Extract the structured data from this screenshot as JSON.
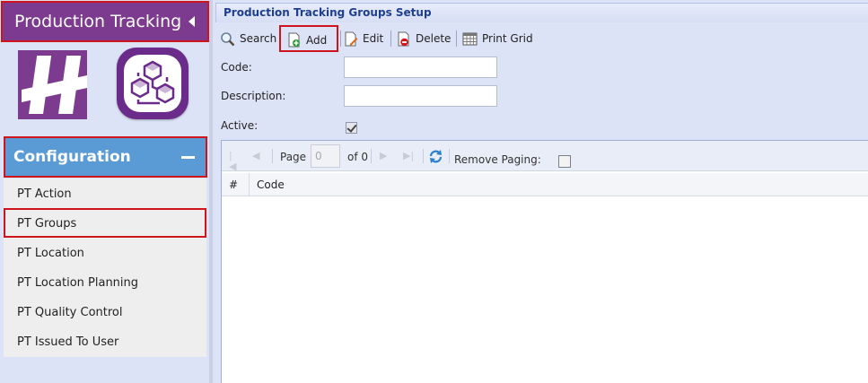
{
  "sidebar": {
    "header_title": "Production Tracking",
    "config_title": "Configuration",
    "items": [
      {
        "label": "PT Action"
      },
      {
        "label": "PT Groups"
      },
      {
        "label": "PT Location"
      },
      {
        "label": "PT Location Planning"
      },
      {
        "label": "PT Quality Control"
      },
      {
        "label": "PT Issued To User"
      }
    ],
    "active_index": 1,
    "colors": {
      "brand_purple": "#7d3b8f",
      "config_blue": "#5b9bd5",
      "highlight_red": "#d0141b"
    }
  },
  "main": {
    "title": "Production Tracking Groups Setup",
    "toolbar": {
      "search": {
        "label": "Search",
        "icon": "magnifier-icon"
      },
      "add": {
        "label": "Add",
        "icon": "add-document-icon"
      },
      "edit": {
        "label": "Edit",
        "icon": "edit-document-icon"
      },
      "delete": {
        "label": "Delete",
        "icon": "delete-document-icon"
      },
      "print": {
        "label": "Print Grid",
        "icon": "grid-table-icon"
      }
    },
    "form": {
      "code_label": "Code:",
      "code_value": "",
      "description_label": "Description:",
      "description_value": "",
      "active_label": "Active:",
      "active_checked": true
    },
    "grid": {
      "pager": {
        "page_label": "Page",
        "page_value": "0",
        "of_label": "of 0",
        "remove_paging_label": "Remove Paging:",
        "remove_paging_checked": false
      },
      "columns": [
        "#",
        "Code"
      ],
      "rows": []
    }
  }
}
